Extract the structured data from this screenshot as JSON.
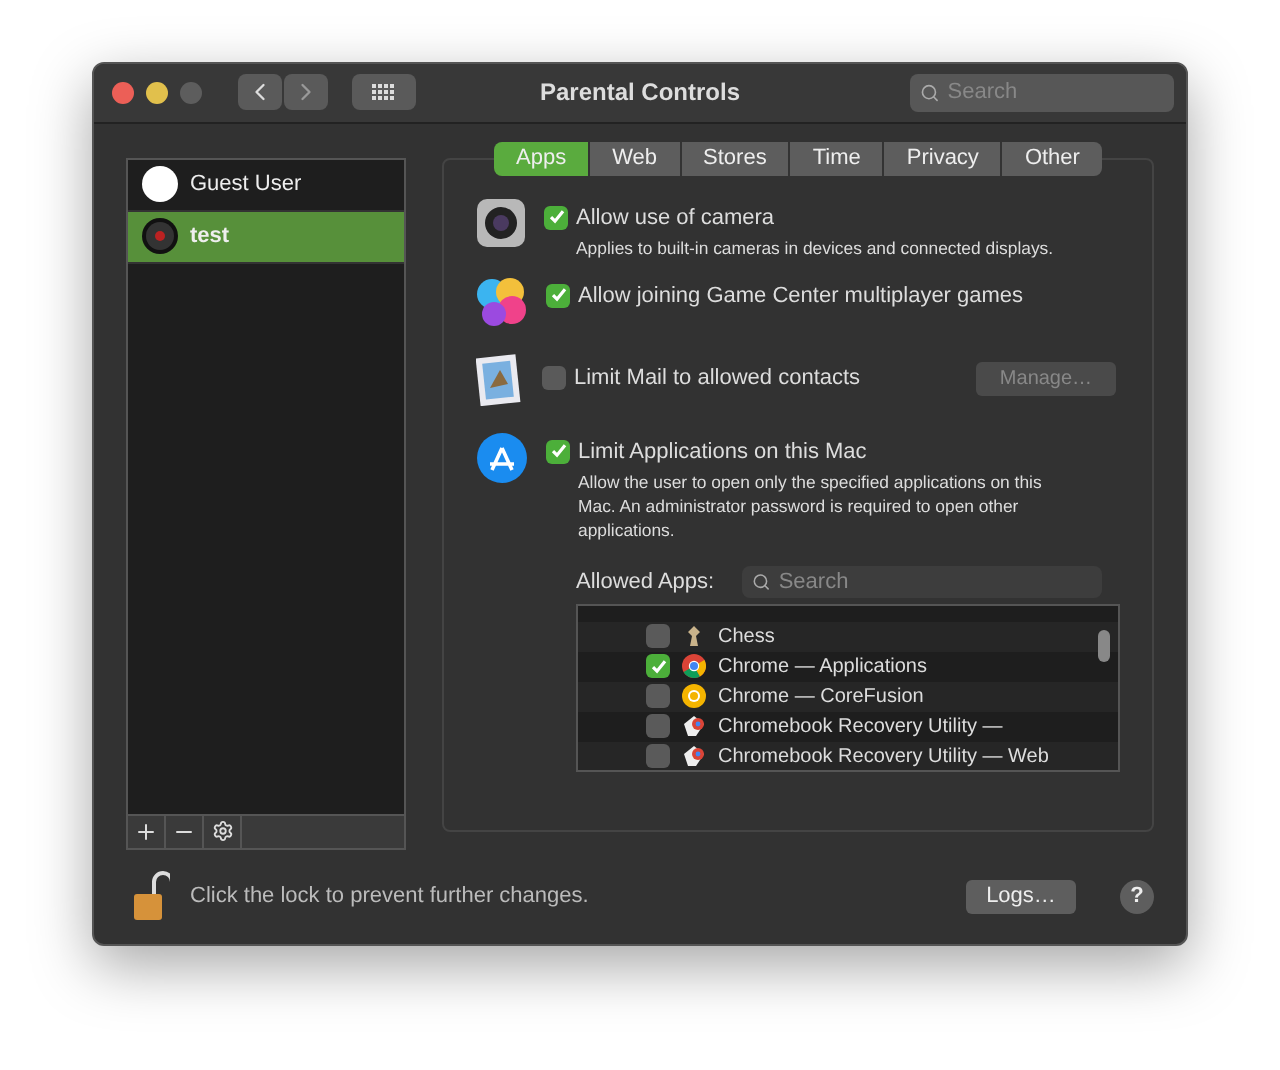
{
  "window": {
    "title": "Parental Controls",
    "search": {
      "placeholder": "Search"
    }
  },
  "users": [
    {
      "name": "Guest User",
      "kind": "guest",
      "selected": false
    },
    {
      "name": "test",
      "kind": "record",
      "selected": true
    }
  ],
  "tabs": [
    {
      "label": "Apps",
      "selected": true
    },
    {
      "label": "Web",
      "selected": false
    },
    {
      "label": "Stores",
      "selected": false
    },
    {
      "label": "Time",
      "selected": false
    },
    {
      "label": "Privacy",
      "selected": false
    },
    {
      "label": "Other",
      "selected": false
    }
  ],
  "options": [
    {
      "kind": "camera",
      "label": "Allow use of camera",
      "checked": true,
      "description": "Applies to built-in cameras in devices and connected displays."
    },
    {
      "kind": "gamecenter",
      "label": "Allow joining Game Center multiplayer games",
      "checked": true
    },
    {
      "kind": "mail",
      "label": "Limit Mail to allowed contacts",
      "checked": false,
      "button": {
        "label": "Manage…",
        "disabled": true
      }
    },
    {
      "kind": "appstore",
      "label": "Limit Applications on this Mac",
      "checked": true,
      "description": "Allow the user to open only the specified applications on this Mac. An administrator password is required to open other applications."
    }
  ],
  "allowed_apps": {
    "label": "Allowed Apps:",
    "search": {
      "placeholder": "Search"
    },
    "apps": [
      {
        "kind": "chess",
        "name": "Chess",
        "checked": false
      },
      {
        "kind": "chrome",
        "name": "Chrome — Applications",
        "checked": true
      },
      {
        "kind": "chromeyellow",
        "name": "Chrome — CoreFusion",
        "checked": false
      },
      {
        "kind": "recovery",
        "name": "Chromebook Recovery Utility —",
        "checked": false
      },
      {
        "kind": "recovery",
        "name": "Chromebook Recovery Utility — Web",
        "checked": false
      }
    ]
  },
  "footer": {
    "message": "Click the lock to prevent further changes.",
    "locked": false,
    "logs_button": "Logs…",
    "help": "?"
  }
}
